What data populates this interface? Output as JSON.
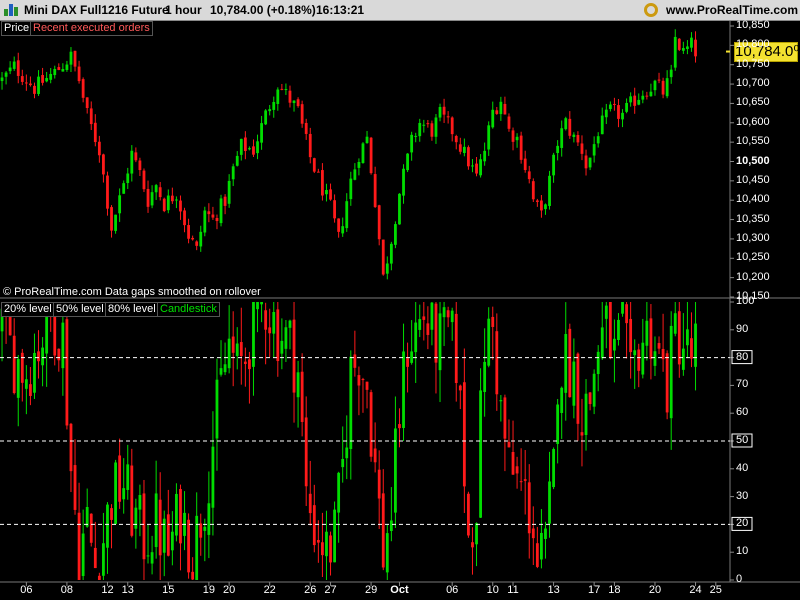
{
  "titlebar": {
    "instrument": "Mini DAX Full1216 Future",
    "timeframe": "1 hour",
    "last": "10,784.00 (+0.18%)",
    "time": "16:13:21",
    "site": "www.ProRealTime.com"
  },
  "icons": {
    "app": "bar-chart-icon",
    "settings": "gear-icon"
  },
  "colors": {
    "up": "#00dd00",
    "down": "#ff1a1a",
    "background": "#000000",
    "price_box": "#f4e230"
  },
  "price_panel": {
    "legend": [
      "Price",
      "Recent executed orders"
    ],
    "footer": "© ProRealTime.com  Data gaps smoothed on rollover",
    "current_price_label": "10,784.0⁰"
  },
  "indicator_panel": {
    "legend": [
      "20% level",
      "50% level",
      "80% level",
      "Candlestick"
    ]
  },
  "chart_data": [
    {
      "type": "candlestick",
      "ylim": [
        10150,
        10850
      ],
      "yticks": [
        "10,850",
        "10,800",
        "10,750",
        "10,700",
        "10,650",
        "10,600",
        "10,550",
        "10,500",
        "10,450",
        "10,400",
        "10,350",
        "10,300",
        "10,250",
        "10,200",
        "10,150"
      ],
      "y_highlight": "10,500",
      "last_price": 10784.0,
      "keypoints": [
        [
          0,
          10710
        ],
        [
          3,
          10745
        ],
        [
          8,
          10690
        ],
        [
          13,
          10730
        ],
        [
          17,
          10770
        ],
        [
          19,
          10710
        ],
        [
          21,
          10620
        ],
        [
          24,
          10530
        ],
        [
          27,
          10330
        ],
        [
          30,
          10440
        ],
        [
          32,
          10520
        ],
        [
          34,
          10470
        ],
        [
          36,
          10400
        ],
        [
          38,
          10440
        ],
        [
          40,
          10390
        ],
        [
          43,
          10420
        ],
        [
          46,
          10310
        ],
        [
          48,
          10270
        ],
        [
          50,
          10370
        ],
        [
          52,
          10350
        ],
        [
          55,
          10400
        ],
        [
          57,
          10480
        ],
        [
          59,
          10540
        ],
        [
          62,
          10530
        ],
        [
          65,
          10620
        ],
        [
          68,
          10700
        ],
        [
          71,
          10660
        ],
        [
          73,
          10630
        ],
        [
          76,
          10510
        ],
        [
          79,
          10430
        ],
        [
          81,
          10380
        ],
        [
          83,
          10300
        ],
        [
          86,
          10450
        ],
        [
          88,
          10520
        ],
        [
          90,
          10560
        ],
        [
          92,
          10400
        ],
        [
          94,
          10200
        ],
        [
          96,
          10300
        ],
        [
          98,
          10420
        ],
        [
          101,
          10550
        ],
        [
          103,
          10600
        ],
        [
          106,
          10580
        ],
        [
          108,
          10620
        ],
        [
          111,
          10580
        ],
        [
          113,
          10540
        ],
        [
          115,
          10500
        ],
        [
          117,
          10460
        ],
        [
          119,
          10530
        ],
        [
          121,
          10630
        ],
        [
          123,
          10660
        ],
        [
          125,
          10580
        ],
        [
          127,
          10560
        ],
        [
          130,
          10450
        ],
        [
          131,
          10400
        ],
        [
          133,
          10360
        ],
        [
          135,
          10450
        ],
        [
          137,
          10550
        ],
        [
          139,
          10600
        ],
        [
          141,
          10560
        ],
        [
          143,
          10530
        ],
        [
          144,
          10490
        ],
        [
          145,
          10510
        ],
        [
          147,
          10580
        ],
        [
          150,
          10630
        ],
        [
          153,
          10620
        ],
        [
          156,
          10660
        ],
        [
          158,
          10680
        ],
        [
          161,
          10700
        ],
        [
          163,
          10680
        ],
        [
          165,
          10720
        ],
        [
          166,
          10820
        ],
        [
          168,
          10780
        ],
        [
          170,
          10800
        ],
        [
          171,
          10784
        ]
      ]
    },
    {
      "type": "candlestick",
      "ylim": [
        0,
        100
      ],
      "yticks": [
        "100",
        "90",
        "80",
        "70",
        "60",
        "50",
        "40",
        "30",
        "20",
        "10",
        "0"
      ],
      "levels": [
        20,
        50,
        80
      ],
      "keypoints": [
        [
          0,
          90
        ],
        [
          3,
          80
        ],
        [
          6,
          75
        ],
        [
          9,
          85
        ],
        [
          12,
          95
        ],
        [
          15,
          88
        ],
        [
          17,
          40
        ],
        [
          19,
          10
        ],
        [
          21,
          20
        ],
        [
          23,
          5
        ],
        [
          25,
          15
        ],
        [
          27,
          30
        ],
        [
          30,
          35
        ],
        [
          32,
          25
        ],
        [
          35,
          15
        ],
        [
          38,
          20
        ],
        [
          41,
          10
        ],
        [
          44,
          25
        ],
        [
          47,
          10
        ],
        [
          50,
          30
        ],
        [
          52,
          50
        ],
        [
          54,
          70
        ],
        [
          56,
          85
        ],
        [
          58,
          75
        ],
        [
          60,
          80
        ],
        [
          62,
          95
        ],
        [
          65,
          100
        ],
        [
          68,
          90
        ],
        [
          71,
          85
        ],
        [
          73,
          75
        ],
        [
          75,
          30
        ],
        [
          77,
          20
        ],
        [
          80,
          10
        ],
        [
          82,
          15
        ],
        [
          84,
          40
        ],
        [
          86,
          75
        ],
        [
          88,
          80
        ],
        [
          90,
          70
        ],
        [
          92,
          40
        ],
        [
          94,
          10
        ],
        [
          96,
          25
        ],
        [
          98,
          60
        ],
        [
          100,
          85
        ],
        [
          102,
          90
        ],
        [
          104,
          95
        ],
        [
          106,
          88
        ],
        [
          108,
          85
        ],
        [
          110,
          90
        ],
        [
          112,
          80
        ],
        [
          114,
          40
        ],
        [
          115,
          15
        ],
        [
          117,
          30
        ],
        [
          119,
          85
        ],
        [
          121,
          90
        ],
        [
          123,
          60
        ],
        [
          125,
          40
        ],
        [
          127,
          35
        ],
        [
          129,
          30
        ],
        [
          131,
          20
        ],
        [
          132,
          5
        ],
        [
          134,
          10
        ],
        [
          136,
          40
        ],
        [
          137,
          75
        ],
        [
          139,
          80
        ],
        [
          141,
          75
        ],
        [
          143,
          60
        ],
        [
          145,
          65
        ],
        [
          147,
          85
        ],
        [
          149,
          90
        ],
        [
          151,
          80
        ],
        [
          153,
          90
        ],
        [
          155,
          70
        ],
        [
          157,
          85
        ],
        [
          160,
          90
        ],
        [
          162,
          80
        ],
        [
          164,
          70
        ],
        [
          166,
          90
        ],
        [
          168,
          85
        ],
        [
          170,
          80
        ],
        [
          171,
          85
        ]
      ]
    }
  ],
  "x_axis": {
    "labels": [
      {
        "text": "06",
        "i": 6
      },
      {
        "text": "08",
        "i": 16
      },
      {
        "text": "12",
        "i": 26
      },
      {
        "text": "13",
        "i": 31
      },
      {
        "text": "15",
        "i": 41
      },
      {
        "text": "19",
        "i": 51
      },
      {
        "text": "20",
        "i": 56
      },
      {
        "text": "22",
        "i": 66
      },
      {
        "text": "26",
        "i": 76
      },
      {
        "text": "27",
        "i": 81
      },
      {
        "text": "29",
        "i": 91
      },
      {
        "text": "Oct",
        "i": 98
      },
      {
        "text": "06",
        "i": 111
      },
      {
        "text": "10",
        "i": 121
      },
      {
        "text": "11",
        "i": 126
      },
      {
        "text": "13",
        "i": 136
      },
      {
        "text": "17",
        "i": 146
      },
      {
        "text": "18",
        "i": 151
      },
      {
        "text": "20",
        "i": 161
      },
      {
        "text": "24",
        "i": 171
      },
      {
        "text": "25",
        "i": 176
      }
    ]
  }
}
